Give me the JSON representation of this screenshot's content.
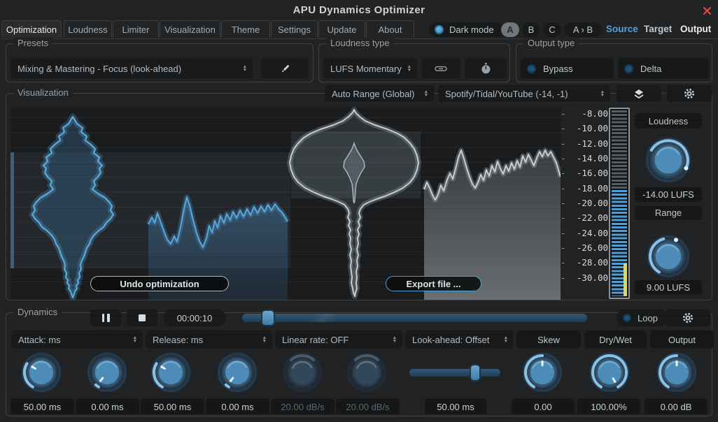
{
  "title_bar": {
    "title": "APU Dynamics Optimizer"
  },
  "tabs": [
    {
      "label": "Optimization"
    },
    {
      "label": "Loudness"
    },
    {
      "label": "Limiter"
    },
    {
      "label": "Visualization"
    },
    {
      "label": "Theme"
    },
    {
      "label": "Settings"
    },
    {
      "label": "Update"
    },
    {
      "label": "About"
    }
  ],
  "topbar": {
    "dark_mode": "Dark mode",
    "a": "A",
    "b": "B",
    "c": "C",
    "ab_copy": "A › B",
    "source": "Source",
    "target": "Target",
    "output": "Output",
    "source_color": "#4da3e0"
  },
  "presets": {
    "label": "Presets",
    "value": "Mixing & Mastering - Focus (look-ahead)"
  },
  "loudness_type": {
    "label": "Loudness type",
    "value": "LUFS Momentary"
  },
  "output_type": {
    "label": "Output type",
    "bypass": "Bypass",
    "delta": "Delta"
  },
  "viz": {
    "label": "Visualization",
    "range_mode": "Auto Range (Global)",
    "target_preset": "Spotify/Tidal/YouTube (-14, -1)",
    "undo": "Undo optimization",
    "export": "Export file ...",
    "ticks": [
      "-8.00",
      "-10.00",
      "-12.00",
      "-14.00",
      "-16.00",
      "-18.00",
      "-20.00",
      "-22.00",
      "-24.00",
      "-26.00",
      "-28.00",
      "-30.00"
    ],
    "loudness_label": "Loudness",
    "loudness_value": "-14.00 LUFS",
    "range_label": "Range",
    "range_value": "9.00 LUFS",
    "accent": "#4da0d8",
    "meter_yellow": "#d9d957"
  },
  "dynamics": {
    "label": "Dynamics",
    "time": "00:00:10",
    "loop": "Loop",
    "headers": [
      {
        "label": "Attack: ms"
      },
      {
        "label": "Release: ms"
      },
      {
        "label": "Linear rate: OFF"
      },
      {
        "label": "Look-ahead: Offset"
      },
      {
        "label": "Skew"
      },
      {
        "label": "Dry/Wet"
      },
      {
        "label": "Output"
      }
    ],
    "values": [
      "50.00 ms",
      "0.00 ms",
      "50.00 ms",
      "0.00 ms",
      "20.00 dB/s",
      "20.00 dB/s",
      "50.00 ms",
      "0.00",
      "100.00%",
      "0.00 dB"
    ]
  },
  "icons": {
    "close": "red-x",
    "edit": "pencil",
    "link": "chain",
    "timer": "stopwatch",
    "layers": "layers",
    "settings": "gear",
    "pause": "pause",
    "stop": "stop"
  }
}
